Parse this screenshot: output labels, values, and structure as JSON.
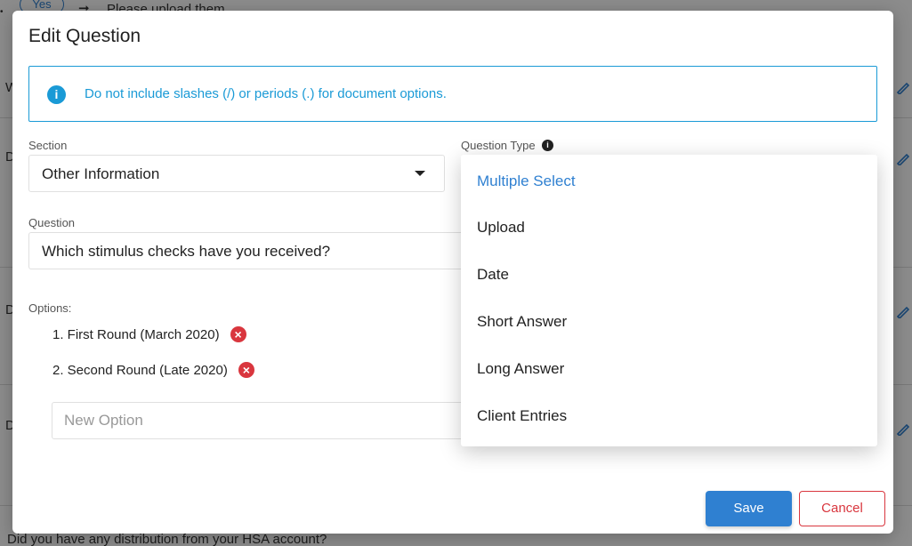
{
  "background": {
    "pill_label": "Yes",
    "top_text": "Please upload them",
    "bottom_text": "Did you have any distribution from your HSA account?",
    "row_letters": [
      "W",
      "D",
      "D",
      "D"
    ]
  },
  "modal": {
    "title": "Edit Question",
    "info_text": "Do not include slashes (/) or periods (.) for document options.",
    "section": {
      "label": "Section",
      "value": "Other Information"
    },
    "question_type": {
      "label": "Question Type",
      "options": [
        "Multiple Select",
        "Upload",
        "Date",
        "Short Answer",
        "Long Answer",
        "Client Entries"
      ],
      "selected": "Multiple Select"
    },
    "question": {
      "label": "Question",
      "value": "Which stimulus checks have you received?"
    },
    "options": {
      "label": "Options:",
      "items": [
        "1. First Round (March 2020)",
        "2. Second Round (Late 2020)"
      ],
      "new_placeholder": "New Option"
    },
    "save_label": "Save",
    "cancel_label": "Cancel"
  },
  "colors": {
    "accent": "#2f80d1",
    "info": "#1a9ad6",
    "danger": "#d9363e"
  }
}
